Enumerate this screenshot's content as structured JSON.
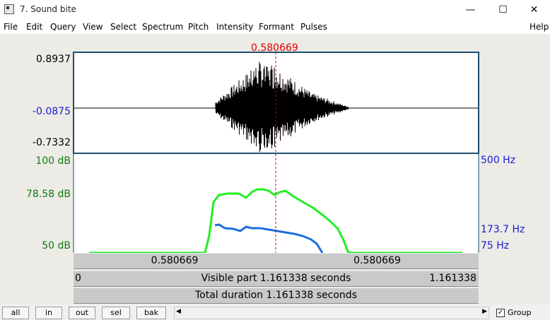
{
  "window": {
    "title": "7. Sound bite",
    "minimize_glyph": "—",
    "maximize_glyph": "☐",
    "close_glyph": "✕"
  },
  "menu": [
    "File",
    "Edit",
    "Query",
    "View",
    "Select",
    "Spectrum",
    "Pitch",
    "Intensity",
    "Formant",
    "Pulses",
    "Help"
  ],
  "cursor": {
    "time_label": "0.580669",
    "time": 0.580669
  },
  "waveform": {
    "y_max": "0.8937",
    "y_cursor": "-0.0875",
    "y_min": "-0.7332",
    "range": [
      -0.7332,
      0.8937
    ]
  },
  "intensity": {
    "top_label": "100 dB",
    "mid_label": "78.58 dB",
    "bottom_label": "50 dB",
    "range": [
      50,
      100
    ],
    "color": "#22ee22"
  },
  "pitch": {
    "top_label": "500 Hz",
    "mid_label": "173.7 Hz",
    "bottom_label": "75 Hz",
    "color": "#1a70dd"
  },
  "selection_bar": {
    "left_label": "0.580669",
    "right_label": "0.580669"
  },
  "visible_bar": {
    "start": "0",
    "text": "Visible part 1.161338 seconds",
    "end": "1.161338"
  },
  "total_bar": {
    "text": "Total duration 1.161338 seconds"
  },
  "buttons": {
    "all": "all",
    "in": "in",
    "out": "out",
    "sel": "sel",
    "bak": "bak"
  },
  "scroll": {
    "left_arrow": "◀",
    "right_arrow": "▶"
  },
  "group": {
    "label": "Group",
    "checked": true,
    "check_glyph": "✓"
  },
  "colors": {
    "cursor_red": "#e00000",
    "label_blue": "#1a1ad0",
    "label_green": "#117a11",
    "frame": "#1f4f6f"
  }
}
